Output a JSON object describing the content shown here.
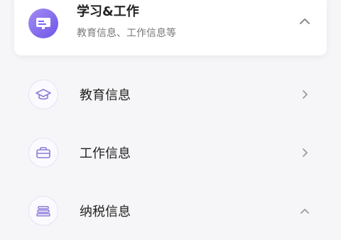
{
  "header": {
    "title": "学习&工作",
    "subtitle": "教育信息、工作信息等",
    "icon": "id-card-icon",
    "expanded": true
  },
  "items": [
    {
      "label": "教育信息",
      "icon": "graduation-cap-icon",
      "chevron": "chevron-right-icon"
    },
    {
      "label": "工作信息",
      "icon": "briefcase-icon",
      "chevron": "chevron-right-icon"
    },
    {
      "label": "纳税信息",
      "icon": "tax-icon",
      "chevron": "chevron-up-icon"
    }
  ],
  "colors": {
    "accent": "#7b61ff",
    "icon_stroke": "#8c7bd9",
    "chevron": "#9a9a9a"
  }
}
